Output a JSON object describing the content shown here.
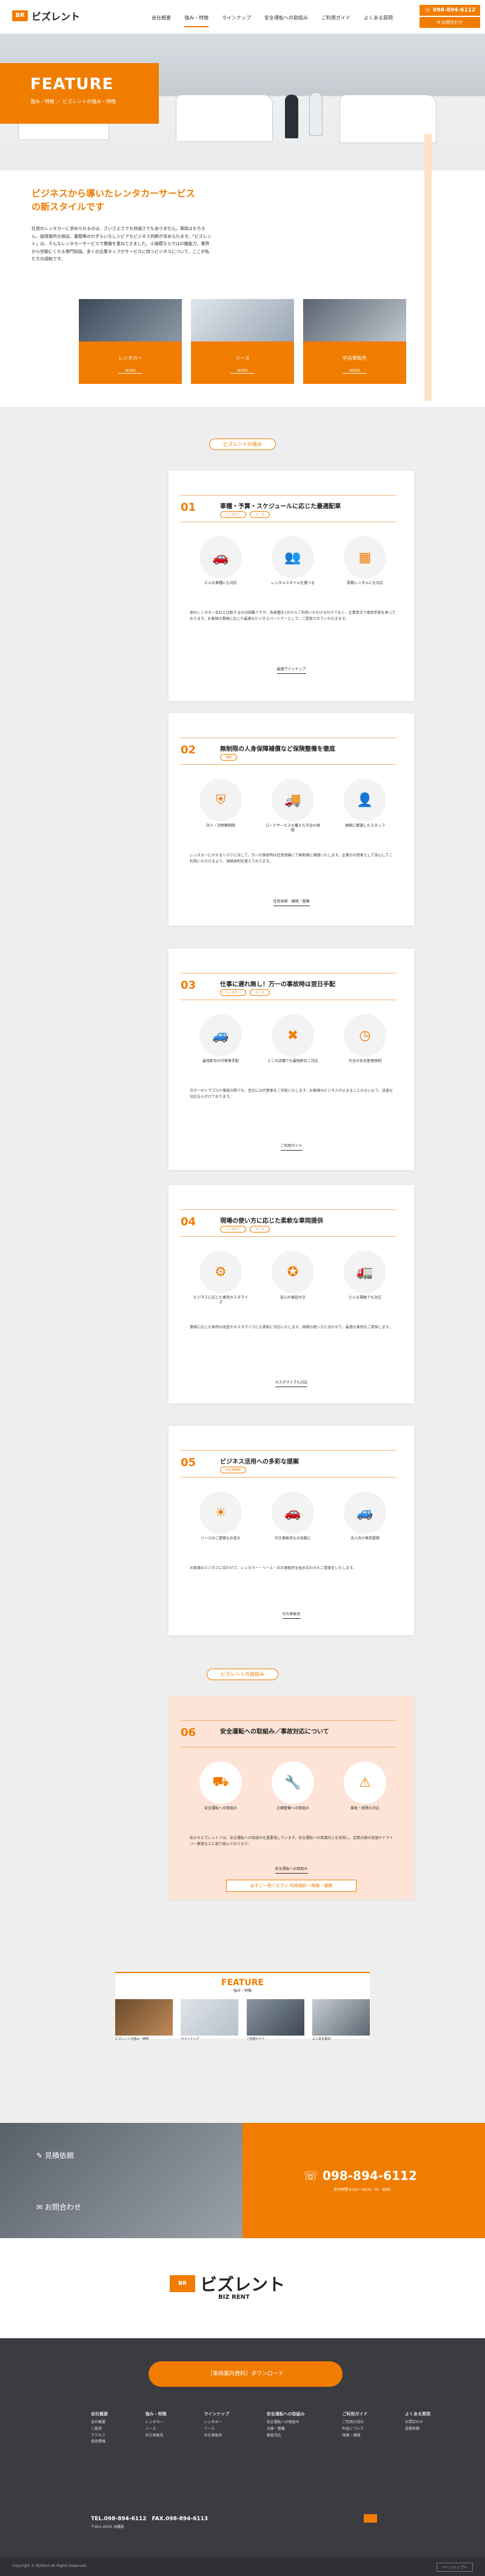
{
  "header": {
    "logo": "ビズレント",
    "nav": [
      "会社概要",
      "強み・特徴",
      "ラインナップ",
      "安全運転への取組み",
      "ご利用ガイド",
      "よくある質問"
    ],
    "tel": "098-894-6112",
    "contact": "お問合わせ"
  },
  "hero": {
    "title": "FEATURE",
    "subtitle": "強み・特徴 ／ ビズレントの強み・特徴"
  },
  "intro": {
    "heading": "ビジネスから導いたレンタカーサービスの新スタイルです",
    "text": "社用のレンタカーに求められるのは、さいさよさでも快適さでもありません。事故はもちろん、故障箇所の保証、書類等のわずらいなしシビアなビジネス判断が求められます。「ビズレント」は、そんなレンタカーサービスで業績を重ねてきました。小規模ならではの機能力、業界から信頼にくなる専門知識、多くの企業タッフがサービスに持つビジネスについて、ここが私たちの調和です。",
    "cards": [
      {
        "label": "レンタカー",
        "more": "MORE"
      },
      {
        "label": "リース",
        "more": "MORE"
      },
      {
        "label": "中古車販売",
        "more": "MORE"
      }
    ]
  },
  "strengths": {
    "pill": "ビズレントの強み",
    "items": [
      {
        "num": "01",
        "title": "車種・予算・スケジュールに応じた最適配車",
        "tags": [
          "レンタカー",
          "リース"
        ],
        "icons": [
          "どんな車種にも対応",
          "レンタルスタイルを選べる",
          "長期レンタルにも対応"
        ],
        "body": "他のレンタカー会社と比較するのは困難ですが、各車種を1台からご利用いただけるだけでなく、企業単位で車両手配を承っております。お客様の業務に応じた最適なビジネスパートナーとして、ご提案させていただきます。",
        "more": "最適ラインナップ"
      },
      {
        "num": "02",
        "title": "無制限の人身保障補償など保険整備を徹底",
        "tags": [
          "保険"
        ],
        "icons": [
          "対人・対物無制限",
          "ロードサービスも備えた万全の保障",
          "保険に精通したスタッフ"
        ],
        "body": "レンタカーにかかるリスクに対して、万一の事故時は任意保険にて無制限に補償いたします。企業の社用車として安心してご利用いただけるよう、保険体制を整えております。",
        "more": "任意保険・補償・整備"
      },
      {
        "num": "03",
        "title": "仕事に遅れ無し！万一の事故時は翌日手配",
        "tags": [
          "レンタカー",
          "リース"
        ],
        "icons": [
          "最短即日の代替車手配",
          "どこの店舗でも最短即日ご対応",
          "万全の安全管理体制"
        ],
        "body": "万が一のトラブルや事故の際でも、翌日には代替車をご手配いたします。お客様のビジネスが止まることのないよう、迅速な対応を心がけております。",
        "more": "ご利用ガイド"
      },
      {
        "num": "04",
        "title": "現場の使い方に応じた柔軟な車両提供",
        "tags": [
          "レンタカー",
          "リース"
        ],
        "icons": [
          "ビジネスに応じた車両カスタマイズ",
          "安心の保証付き",
          "どんな場面でも対応"
        ],
        "body": "業務に応じた車両の改造やカスタマイズにも柔軟に対応いたします。現場の使い方に合わせて、最適な車両をご提供します。",
        "more": "カスタマイズも対応"
      },
      {
        "num": "05",
        "title": "ビジネス活用への多彩な提案",
        "tags": [
          "中古車販売"
        ],
        "icons": [
          "リースのご提案もお任せ",
          "中古車販売もお気軽に",
          "法人向け車両提案"
        ],
        "body": "お客様のビジネスに合わせて、レンタカー・リース・中古車販売を組み合わせたご提案をいたします。",
        "more": "中古車販売"
      }
    ]
  },
  "safety": {
    "pill": "ビズレントの取組み",
    "num": "06",
    "title": "安全運転への取組み／事故対応について",
    "icons": [
      "安全運転への取組み",
      "点検整備への取組み",
      "事故・故障の対応"
    ],
    "body": "私たちビズレントでは、安全運転への取組みを重要視しています。安全運転への意識向上を目指し、定期点検の実施やドライバー教育などに取り組んでおります。",
    "more": "安全運転への取組み",
    "button": "必ずご一読ください 利用規約・保険・補償"
  },
  "feature_block": {
    "title": "FEATURE",
    "subtitle": "強み・特徴",
    "items": [
      "ビズレントの強み・特徴",
      "ラインナップ",
      "ご利用ガイド",
      "よくある質問"
    ]
  },
  "contact_band": {
    "left_top": "見積依頼",
    "left_bottom": "お問合わせ",
    "tel": "098-894-6112",
    "hours": "受付時間 9:00〜18:00（日・祝休）"
  },
  "brand": {
    "logo": "ビズレント",
    "sub": "BIZ RENT"
  },
  "footer": {
    "download": "［車両案内資料］ダウンロード",
    "cols": [
      {
        "h": "会社概要",
        "items": [
          "会社概要",
          "ご挨拶",
          "アクセス",
          "採用情報"
        ]
      },
      {
        "h": "強み・特徴",
        "items": [
          "レンタカー",
          "リース",
          "中古車販売"
        ]
      },
      {
        "h": "ラインナップ",
        "items": [
          "レンタカー",
          "リース",
          "中古車販売"
        ]
      },
      {
        "h": "安全運転への取組み",
        "items": [
          "安全運転への取組み",
          "点検・整備",
          "事故対応"
        ]
      },
      {
        "h": "ご利用ガイド",
        "items": [
          "ご利用の流れ",
          "料金について",
          "保険・補償"
        ]
      },
      {
        "h": "よくある質問",
        "items": [
          "お問合わせ",
          "見積依頼"
        ]
      }
    ],
    "tel": "TEL.098-894-6112　FAX.098-894-6113",
    "address": "〒901-0000 沖縄県",
    "copyright": "Copyright © BizRent All Rights Reserved.",
    "pagetop": "ページトップへ"
  }
}
